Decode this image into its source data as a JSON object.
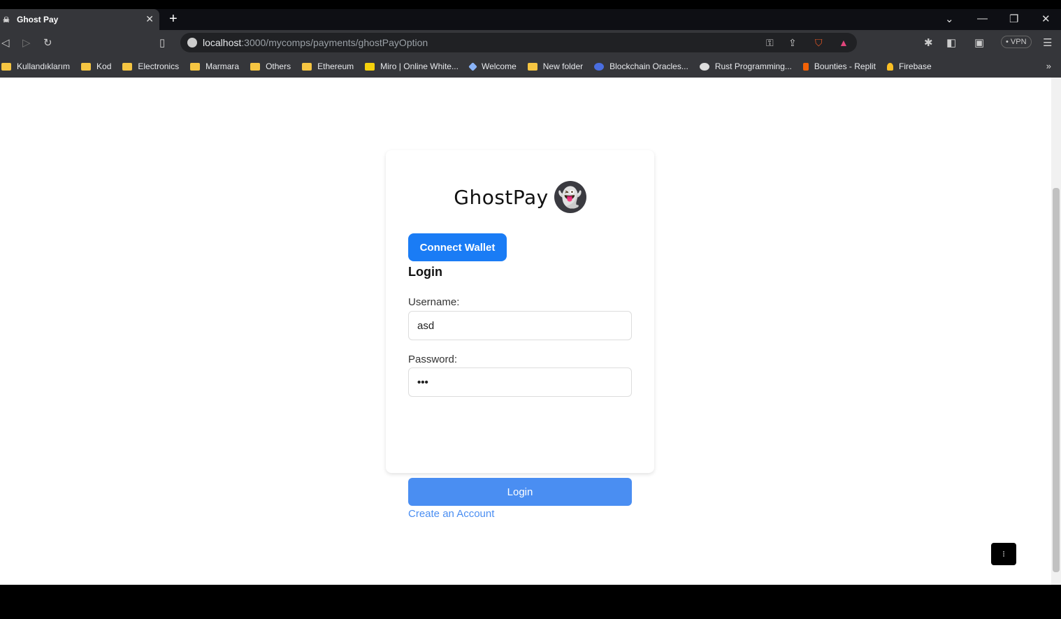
{
  "browser": {
    "tab_title": "Ghost Pay",
    "url_host": "localhost",
    "url_rest": ":3000/mycomps/payments/ghostPayOption",
    "vpn_label": "VPN",
    "bookmarks": [
      "Kullandıklarım",
      "Kod",
      "Electronics",
      "Marmara",
      "Others",
      "Ethereum",
      "Miro | Online White...",
      "Welcome",
      "New folder",
      "Blockchain Oracles...",
      "Rust Programming...",
      "Bounties - Replit",
      "Firebase"
    ]
  },
  "app": {
    "brand": "GhostPay",
    "connect_wallet": "Connect Wallet",
    "heading": "Login",
    "username_label": "Username:",
    "username_value": "asd",
    "password_label": "Password:",
    "password_value": "•••",
    "login_button": "Login",
    "create_account": "Create an Account"
  },
  "colors": {
    "primary": "#1a7cf5",
    "login": "#4a8ef2"
  }
}
